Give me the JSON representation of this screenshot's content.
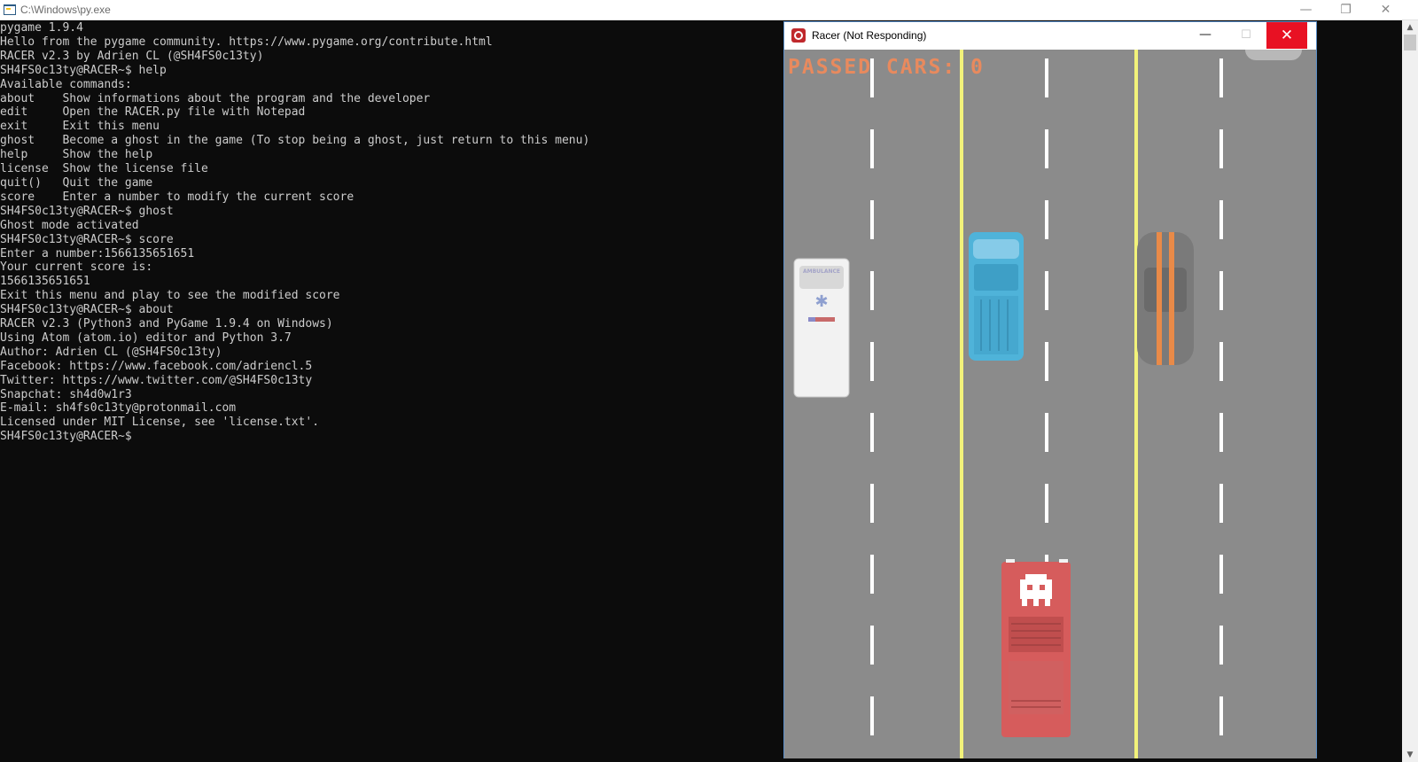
{
  "console": {
    "title": "C:\\Windows\\py.exe",
    "controls": {
      "minimize": "—",
      "restore": "❐",
      "close": "✕"
    },
    "lines": [
      "pygame 1.9.4",
      "Hello from the pygame community. https://www.pygame.org/contribute.html",
      "RACER v2.3 by Adrien CL (@SH4FS0c13ty)",
      "SH4FS0c13ty@RACER~$ help",
      "Available commands:",
      "about    Show informations about the program and the developer",
      "edit     Open the RACER.py file with Notepad",
      "exit     Exit this menu",
      "ghost    Become a ghost in the game (To stop being a ghost, just return to this menu)",
      "help     Show the help",
      "license  Show the license file",
      "quit()   Quit the game",
      "score    Enter a number to modify the current score",
      "SH4FS0c13ty@RACER~$ ghost",
      "Ghost mode activated",
      "SH4FS0c13ty@RACER~$ score",
      "Enter a number:1566135651651",
      "Your current score is:",
      "1566135651651",
      "Exit this menu and play to see the modified score",
      "SH4FS0c13ty@RACER~$ about",
      "RACER v2.3 (Python3 and PyGame 1.9.4 on Windows)",
      "Using Atom (atom.io) editor and Python 3.7",
      "Author: Adrien CL (@SH4FS0c13ty)",
      "Facebook: https://www.facebook.com/adriencl.5",
      "Twitter: https://www.twitter.com/@SH4FS0c13ty",
      "Snapchat: sh4d0w1r3",
      "E-mail: sh4fs0c13ty@protonmail.com",
      "Licensed under MIT License, see 'license.txt'.",
      "SH4FS0c13ty@RACER~$"
    ]
  },
  "racer_window": {
    "title": "Racer (Not Responding)",
    "controls": {
      "minimize": "—",
      "maximize": "☐",
      "close": "✕"
    },
    "hud": {
      "passed_cars_text": "PASSED CARS: 0"
    },
    "vehicles": [
      {
        "name": "ambulance",
        "label": "AMBULANCE",
        "color": "#f2f2f2"
      },
      {
        "name": "pickup-truck",
        "color": "#4fb3d9"
      },
      {
        "name": "muscle-car",
        "color": "#7a7a7a",
        "stripe_color": "#e98a48"
      },
      {
        "name": "player-car",
        "color": "#d65c5c"
      }
    ]
  },
  "colors": {
    "terminal_bg": "#0c0c0c",
    "terminal_text": "#cccccc",
    "road": "#8b8b8b",
    "lane_divider": "#ffffff",
    "center_line": "#f2f27a",
    "hud_text": "#e88a5e",
    "close_button": "#e81123"
  }
}
